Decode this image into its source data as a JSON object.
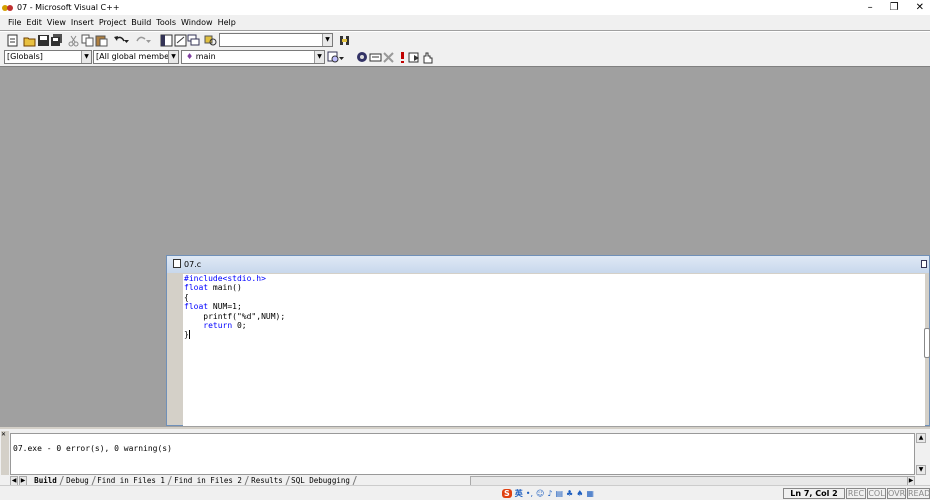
{
  "window": {
    "title": "07 - Microsoft Visual C++"
  },
  "menu": [
    "File",
    "Edit",
    "View",
    "Insert",
    "Project",
    "Build",
    "Tools",
    "Window",
    "Help"
  ],
  "wizardbar": {
    "class_combo": "[Globals]",
    "filter_combo": "[All global members",
    "member_combo": "main"
  },
  "editor": {
    "tab_title": "07.c",
    "lines": [
      "#include<stdio.h>",
      "float main()",
      "{",
      "float NUM=1;",
      "    printf(\"%d\",NUM);",
      "    return 0;",
      "}"
    ]
  },
  "output": {
    "message": "07.exe - 0 error(s), 0 warning(s)",
    "tabs": [
      "Build",
      "Debug",
      "Find in Files 1",
      "Find in Files 2",
      "Results",
      "SQL Debugging"
    ]
  },
  "status": {
    "position": "Ln 7, Col 2",
    "indicators": [
      "REC",
      "COL",
      "OVR",
      "READ"
    ],
    "ime_label": "英"
  },
  "colors": {
    "keyword": "#0000ff",
    "mdi_background": "#a0a0a0",
    "editor_title": "#c8d8ec"
  }
}
